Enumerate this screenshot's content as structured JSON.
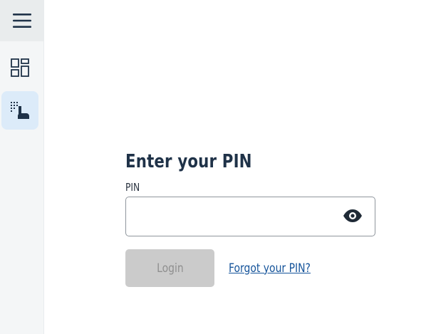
{
  "sidebar": {
    "items": [
      {
        "name": "menu",
        "icon": "hamburger-menu-icon"
      },
      {
        "name": "dashboard",
        "icon": "dashboard-grid-icon"
      },
      {
        "name": "pin-login",
        "icon": "keypad-touch-icon",
        "active": true
      }
    ]
  },
  "header": {
    "title": ""
  },
  "form": {
    "title": "Enter your PIN",
    "pin_label": "PIN",
    "pin_value": "",
    "pin_placeholder": "",
    "login_label": "Login",
    "forgot_label": "Forgot your PIN?"
  },
  "colors": {
    "accent": "#14539a",
    "active_nav_bg": "#dcebf9",
    "disabled_button_bg": "#cbcbcb",
    "title_text": "#1f3248"
  }
}
